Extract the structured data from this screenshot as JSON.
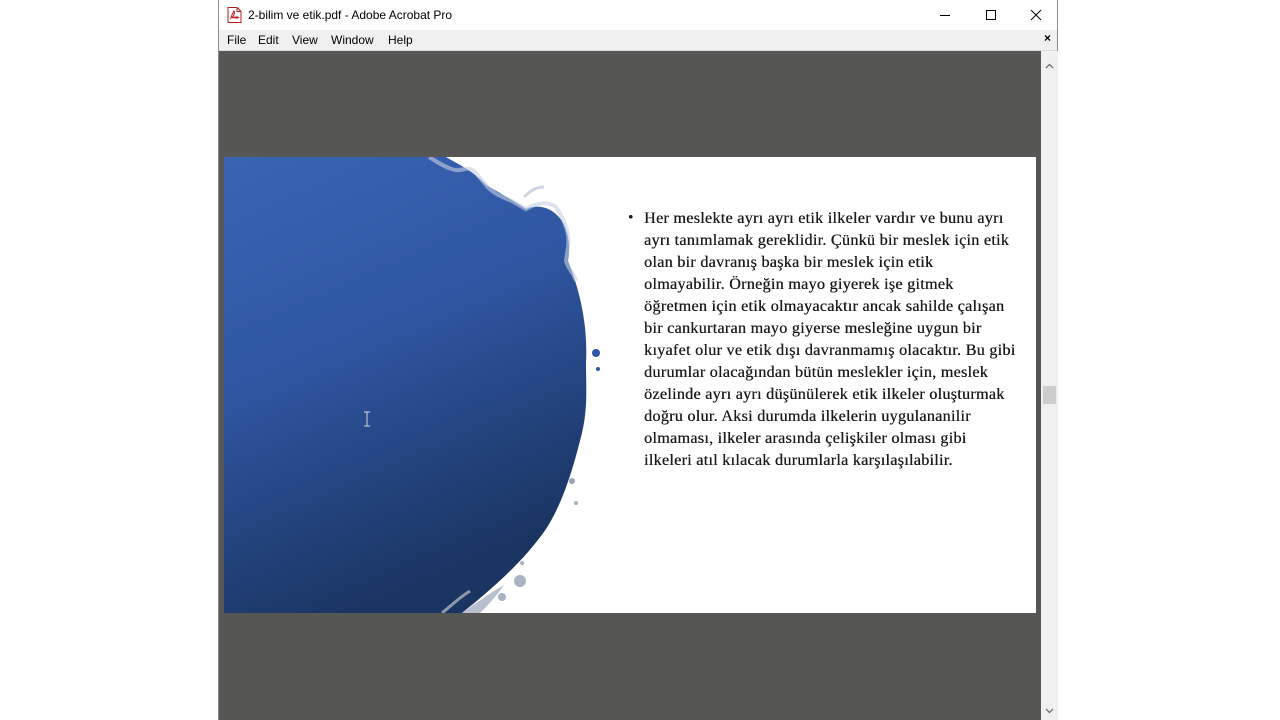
{
  "window": {
    "title": "2-bilim ve etik.pdf - Adobe Acrobat Pro",
    "icon": "pdf-icon",
    "controls": [
      "minimize-icon",
      "maximize-icon",
      "close-icon"
    ]
  },
  "menu": {
    "items": [
      "File",
      "Edit",
      "View",
      "Window",
      "Help"
    ],
    "close_label": "×"
  },
  "document": {
    "bullet": "•",
    "paragraph": "Her meslekte ayrı ayrı etik ilkeler vardır ve bunu ayrı ayrı tanımlamak gereklidir. Çünkü bir meslek için etik olan bir davranış başka bir meslek için etik olmayabilir. Örneğin mayo giyerek işe gitmek öğretmen için etik olmayacaktır ancak sahilde çalışan bir cankurtaran mayo giyerse mesleğine uygun bir kıyafet olur ve etik dışı davranmamış olacaktır. Bu gibi durumlar olacağından bütün meslekler için, meslek özelinde ayrı ayrı düşünülerek etik ilkeler oluşturmak doğru olur. Aksi durumda ilkelerin uygulananilir olmaması, ilkeler arasında çelişkiler olması gibi ilkeleri atıl kılacak durumlarla karşılaşılabilir."
  },
  "colors": {
    "viewer_background": "#565755",
    "blob_light": "#3a64b4",
    "blob_dark": "#1b3563"
  }
}
